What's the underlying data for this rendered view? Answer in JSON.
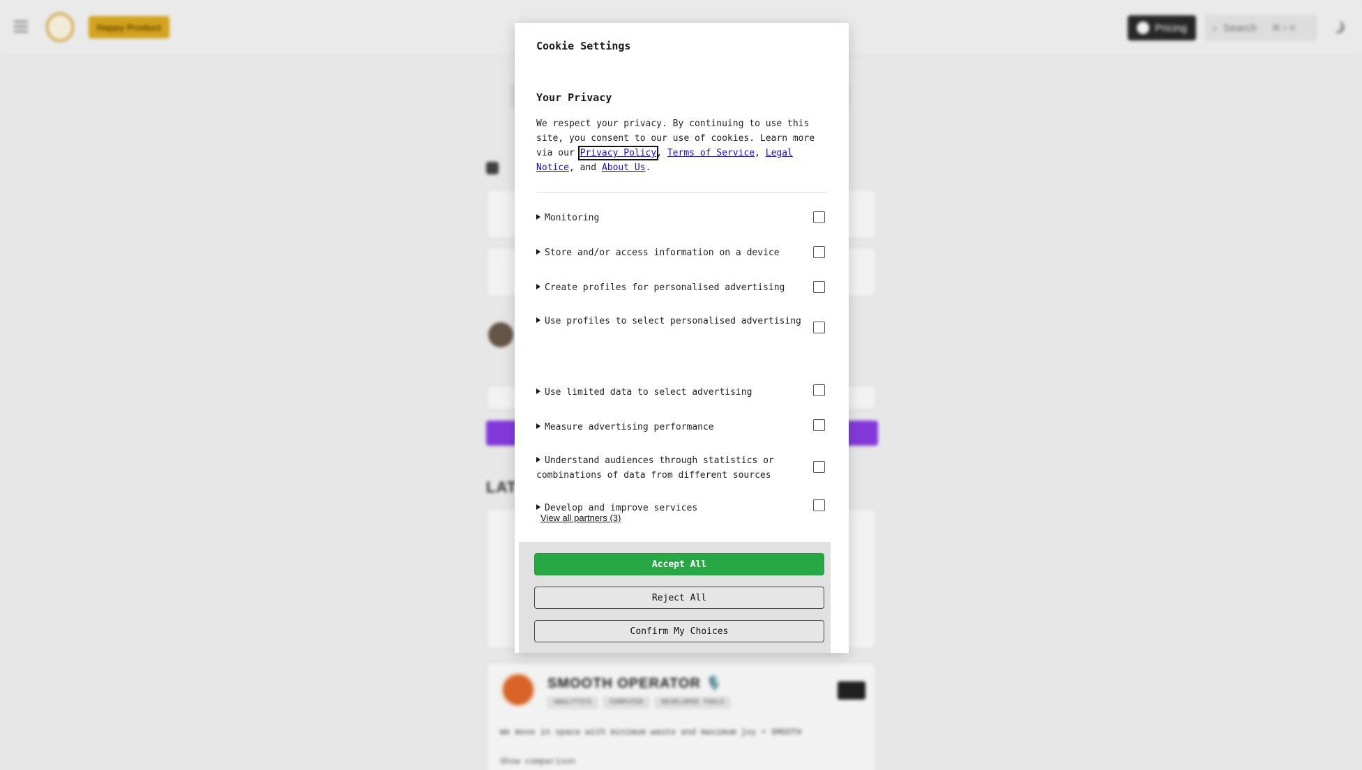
{
  "background": {
    "header": {
      "happy_label": "Happy Product",
      "pricing_label": "Pricing",
      "search_label": "Search",
      "search_shortcut": "⌘ + K"
    },
    "latest_title": "LATEST",
    "smooth_card": {
      "title": "SMOOTH OPERATOR 🎙️",
      "tags": [
        "ANALYTICS",
        "COMPUTER",
        "DEVELOPER TOOLS"
      ],
      "description": "We move in space with minimum waste and maximum joy • SMOOTH",
      "comparison": "Show comparison"
    }
  },
  "cookie_dialog": {
    "title": "Cookie Settings",
    "privacy_heading": "Your Privacy",
    "privacy_text_before": "We respect your privacy. By continuing to use this site, you consent to our use of cookies. Learn more via our ",
    "links": {
      "privacy_policy": "Privacy Policy",
      "terms": "Terms of Service",
      "legal": "Legal Notice",
      "about": "About Us"
    },
    "sep1": ", ",
    "sep2": ", ",
    "sep3": ", and ",
    "end": ".",
    "purposes": [
      {
        "label": "Monitoring",
        "checked": false
      },
      {
        "label": "Store and/or access information on a device",
        "checked": false
      },
      {
        "label": "Create profiles for personalised advertising",
        "checked": false
      },
      {
        "label": "Use profiles to select personalised advertising",
        "checked": false
      },
      {
        "label": "Use limited data to select advertising",
        "checked": false
      },
      {
        "label": "Measure advertising performance",
        "checked": false
      },
      {
        "label": "Understand audiences through statistics or combinations of data from different sources",
        "checked": false
      },
      {
        "label": "Develop and improve services",
        "checked": false
      }
    ],
    "view_partners": "View all partners (3)",
    "buttons": {
      "accept": "Accept All",
      "reject": "Reject All",
      "confirm": "Confirm My Choices"
    },
    "colors": {
      "accept_bg": "#28a745",
      "link": "#1a0dab"
    }
  }
}
